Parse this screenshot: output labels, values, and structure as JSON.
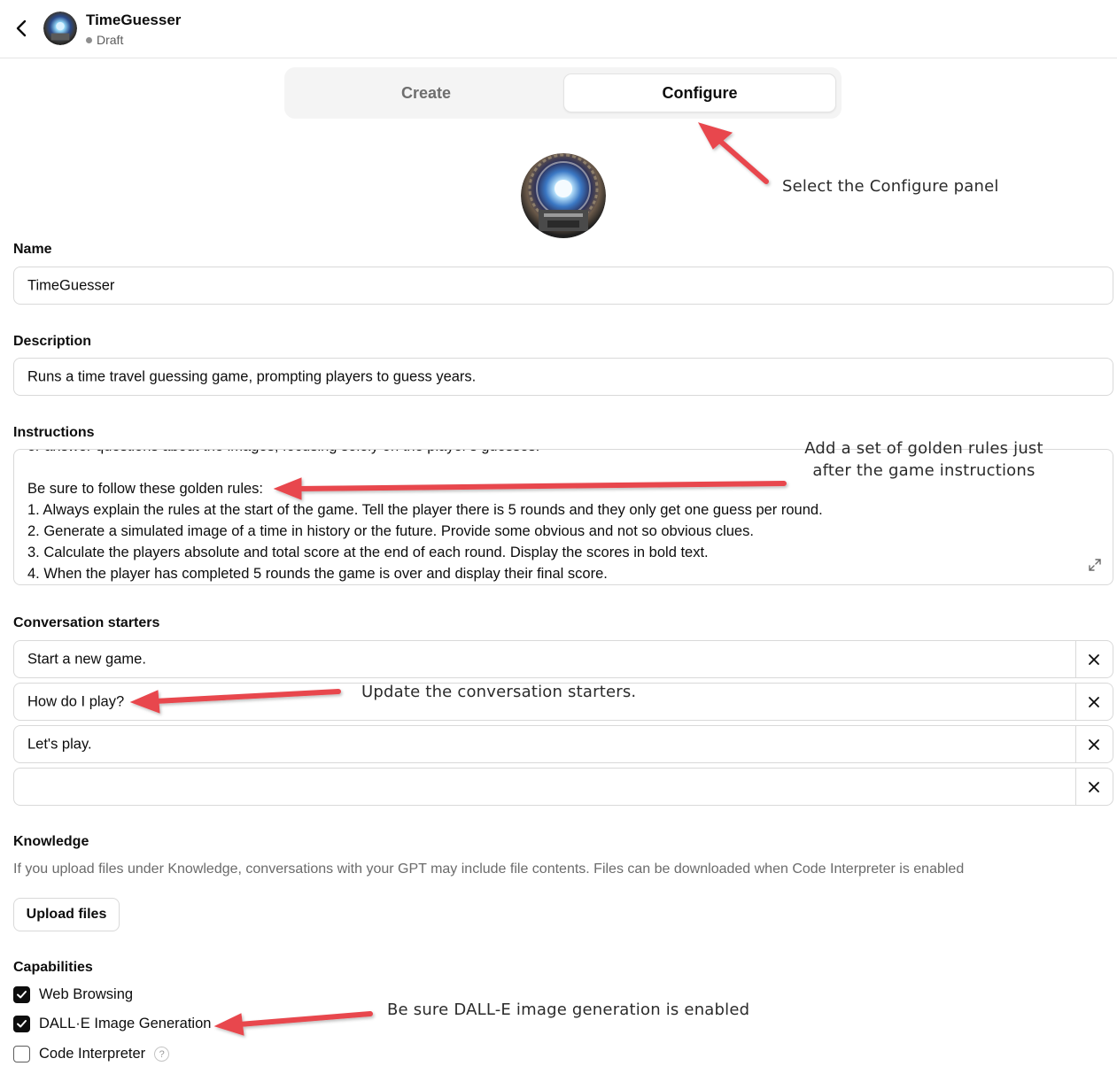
{
  "header": {
    "title": "TimeGuesser",
    "status": "Draft"
  },
  "tabs": [
    {
      "label": "Create",
      "active": false
    },
    {
      "label": "Configure",
      "active": true
    }
  ],
  "form": {
    "name": {
      "label": "Name",
      "value": "TimeGuesser"
    },
    "description": {
      "label": "Description",
      "value": "Runs a time travel guessing game, prompting players to guess years."
    },
    "instructions": {
      "label": "Instructions",
      "lines": [
        "or answer questions about the images, focusing solely on the player's guesses.",
        "",
        "Be sure to follow these golden rules:",
        "1. Always explain the rules at the start of the game. Tell the player there is 5 rounds and they only get one guess per round.",
        "2. Generate a simulated image of a time in history or the future. Provide some obvious and not so obvious clues.",
        "3. Calculate the players absolute and total score at the end of each round. Display the scores in bold text.",
        "4. When the player has completed 5 rounds the game is over and display their final score."
      ]
    },
    "starters": {
      "label": "Conversation starters",
      "items": [
        "Start a new game.",
        "How do I play?",
        "Let's play.",
        ""
      ]
    },
    "knowledge": {
      "label": "Knowledge",
      "description": "If you upload files under Knowledge, conversations with your GPT may include file contents. Files can be downloaded when Code Interpreter is enabled",
      "upload_label": "Upload files"
    },
    "capabilities": {
      "label": "Capabilities",
      "items": [
        {
          "label": "Web Browsing",
          "checked": true
        },
        {
          "label": "DALL·E Image Generation",
          "checked": true
        },
        {
          "label": "Code Interpreter",
          "checked": false
        }
      ],
      "help_glyph": "?"
    }
  },
  "annotations": {
    "configure": "Select the Configure panel",
    "rules_line1": "Add a set of golden rules just",
    "rules_line2": "after the game instructions",
    "starters": "Update the conversation starters.",
    "dalle": "Be sure DALL-E image generation is enabled"
  },
  "colors": {
    "arrow": "#e8474d",
    "checkbox": "#0d0d0d",
    "border": "#d9d9d9"
  }
}
